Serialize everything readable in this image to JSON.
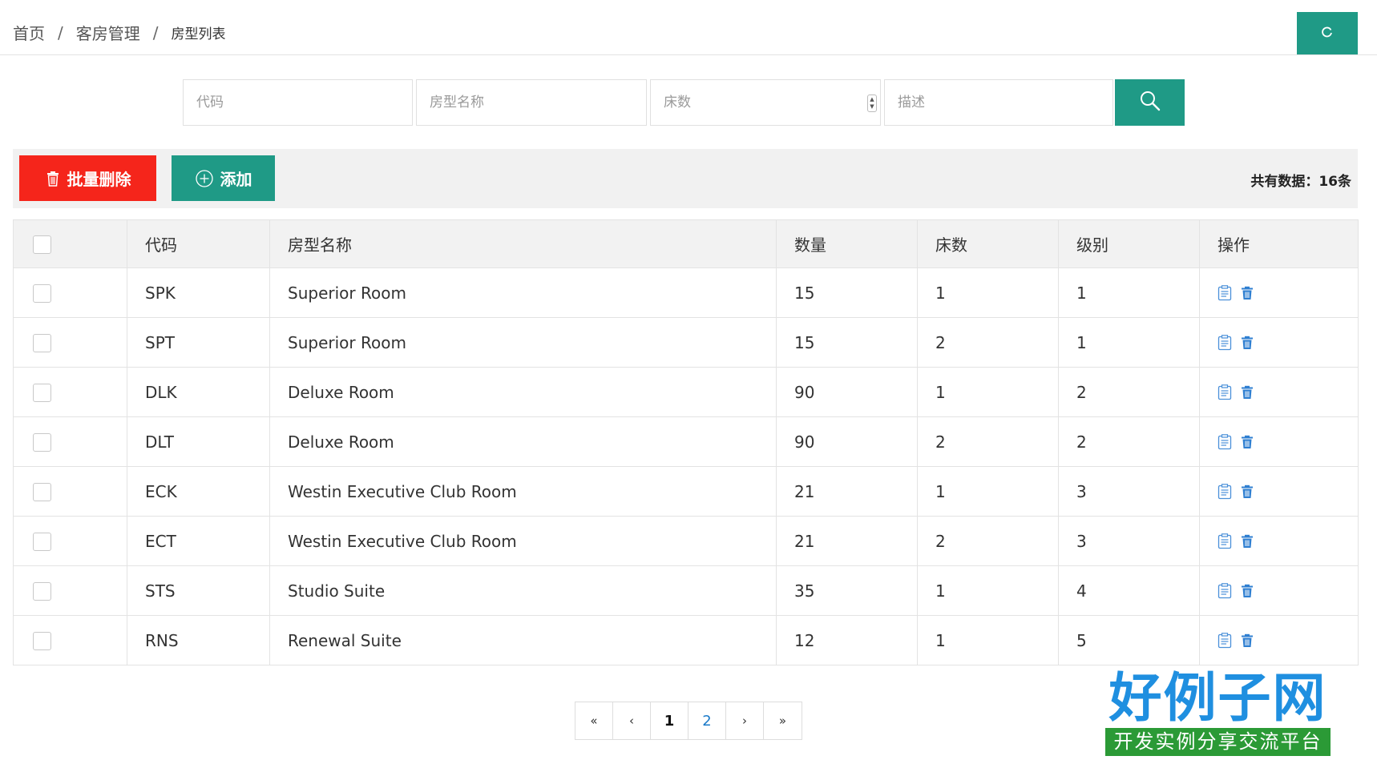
{
  "breadcrumb": {
    "home": "首页",
    "section": "客房管理",
    "current": "房型列表",
    "separator": "/"
  },
  "search": {
    "code_placeholder": "代码",
    "name_placeholder": "房型名称",
    "beds_placeholder": "床数",
    "desc_placeholder": "描述"
  },
  "toolbar": {
    "batch_delete_label": "批量删除",
    "add_label": "添加",
    "total_text": "共有数据：16条"
  },
  "table": {
    "headers": [
      "代码",
      "房型名称",
      "数量",
      "床数",
      "级别",
      "操作"
    ],
    "rows": [
      {
        "code": "SPK",
        "name": "Superior Room",
        "quantity": "15",
        "beds": "1",
        "level": "1"
      },
      {
        "code": "SPT",
        "name": "Superior Room",
        "quantity": "15",
        "beds": "2",
        "level": "1"
      },
      {
        "code": "DLK",
        "name": "Deluxe Room",
        "quantity": "90",
        "beds": "1",
        "level": "2"
      },
      {
        "code": "DLT",
        "name": "Deluxe Room",
        "quantity": "90",
        "beds": "2",
        "level": "2"
      },
      {
        "code": "ECK",
        "name": "Westin Executive Club Room",
        "quantity": "21",
        "beds": "1",
        "level": "3"
      },
      {
        "code": "ECT",
        "name": "Westin Executive Club Room",
        "quantity": "21",
        "beds": "2",
        "level": "3"
      },
      {
        "code": "STS",
        "name": "Studio Suite",
        "quantity": "35",
        "beds": "1",
        "level": "4"
      },
      {
        "code": "RNS",
        "name": "Renewal Suite",
        "quantity": "12",
        "beds": "1",
        "level": "5"
      }
    ]
  },
  "pagination": {
    "first": "«",
    "prev": "‹",
    "pages": [
      "1",
      "2"
    ],
    "current_page": "1",
    "next": "›",
    "last": "»"
  },
  "logo": {
    "title": "好例子网",
    "subtitle": "开发实例分享交流平台"
  },
  "icons": {
    "refresh": "refresh-icon",
    "search": "search-icon",
    "trash": "trash-icon",
    "add": "plus-circle-icon",
    "edit": "edit-icon"
  },
  "colors": {
    "primary": "#1f9a86",
    "danger": "#f5251b",
    "link": "#1a7ac9",
    "logo_blue": "#1f8fe0",
    "logo_green": "#2b9a36"
  }
}
